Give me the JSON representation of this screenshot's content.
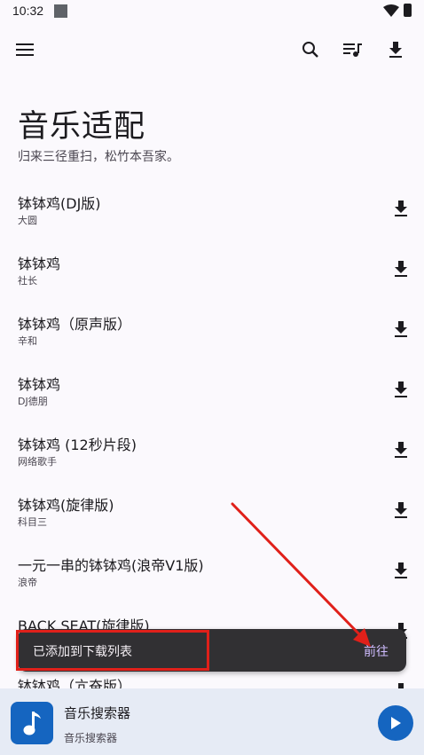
{
  "status_bar": {
    "time": "10:32"
  },
  "toolbar": {
    "menu_icon": "hamburger-menu-icon",
    "search_icon": "search-icon",
    "queue_icon": "queue-music-icon",
    "download_icon": "download-icon"
  },
  "header": {
    "title": "音乐适配",
    "subtitle": "归来三径重扫，松竹本吾家。"
  },
  "songs": [
    {
      "title": "钵钵鸡(DJ版)",
      "artist": "大圆"
    },
    {
      "title": "钵钵鸡",
      "artist": "社长"
    },
    {
      "title": "钵钵鸡（原声版）",
      "artist": "辛和"
    },
    {
      "title": "钵钵鸡",
      "artist": "DJ德朋"
    },
    {
      "title": "钵钵鸡 (12秒片段)",
      "artist": "网络歌手"
    },
    {
      "title": "钵钵鸡(旋律版)",
      "artist": "科目三"
    },
    {
      "title": "一元一串的钵钵鸡(浪帝V1版)",
      "artist": "浪帝"
    },
    {
      "title": "BACK SEAT(旋律版)",
      "artist": ""
    },
    {
      "title": "钵钵鸡（亢奋版）",
      "artist": ""
    }
  ],
  "snackbar": {
    "message": "已添加到下载列表",
    "action": "前往"
  },
  "player": {
    "title": "音乐搜索器",
    "subtitle": "音乐搜索器",
    "art_icon": "music-note-icon",
    "play_icon": "play-icon"
  },
  "colors": {
    "background": "#fbf9fd",
    "accent": "#1565c0",
    "snackbar": "#313033",
    "snack_action": "#cfbcff",
    "annotation": "#e0201a"
  }
}
